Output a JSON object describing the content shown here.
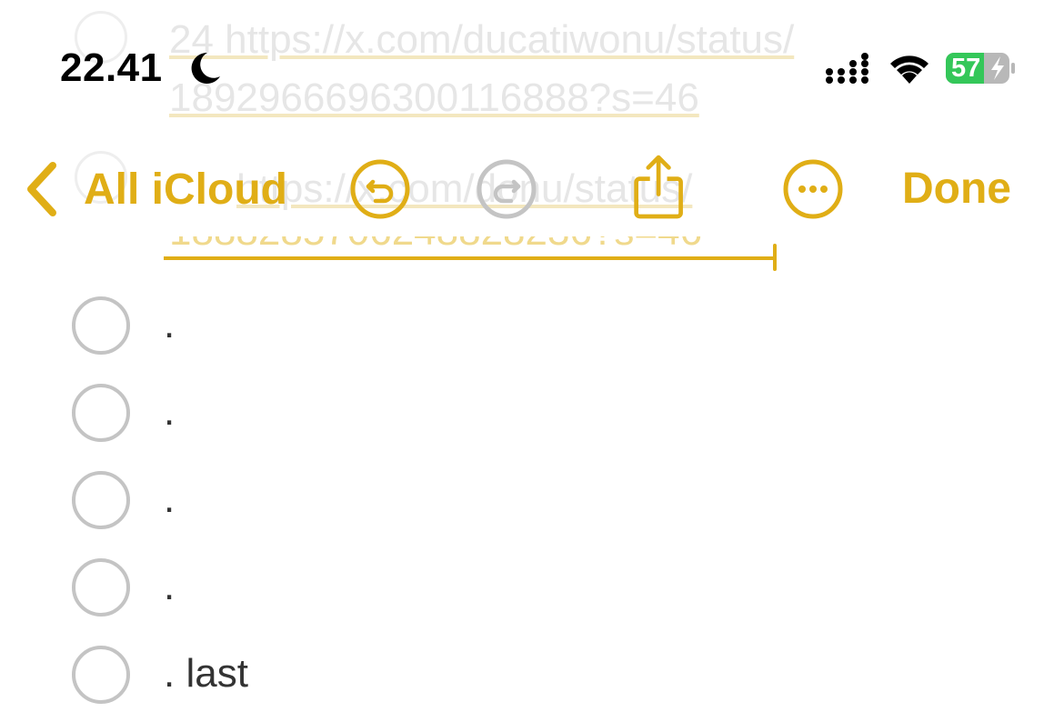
{
  "status_bar": {
    "time": "22.41",
    "battery": "57"
  },
  "toolbar": {
    "back_label": "All iCloud",
    "done_label": "Done"
  },
  "faded_background": {
    "line1": "24 https://x.com/ducatiwonu/status/",
    "line2": "1892966696300116888?s=46",
    "line3": "https://x.com/donu/status/",
    "line4": "1888285706248828236?s=46"
  },
  "checklist": {
    "items": [
      {
        "text": ".",
        "checked": false
      },
      {
        "text": ".",
        "checked": false
      },
      {
        "text": ".",
        "checked": false
      },
      {
        "text": ".",
        "checked": false
      },
      {
        "text": ". last",
        "checked": false
      }
    ]
  },
  "colors": {
    "accent": "#e0ae16",
    "disabled": "#c4c4c4",
    "battery_green": "#34c759"
  },
  "icons": {
    "back": "chevron-left-icon",
    "undo": "undo-icon",
    "redo": "redo-icon",
    "share": "share-icon",
    "more": "ellipsis-circle-icon",
    "dnd": "moon-icon",
    "signal": "cellular-signal-icon",
    "wifi": "wifi-icon",
    "battery": "battery-charging-icon"
  }
}
